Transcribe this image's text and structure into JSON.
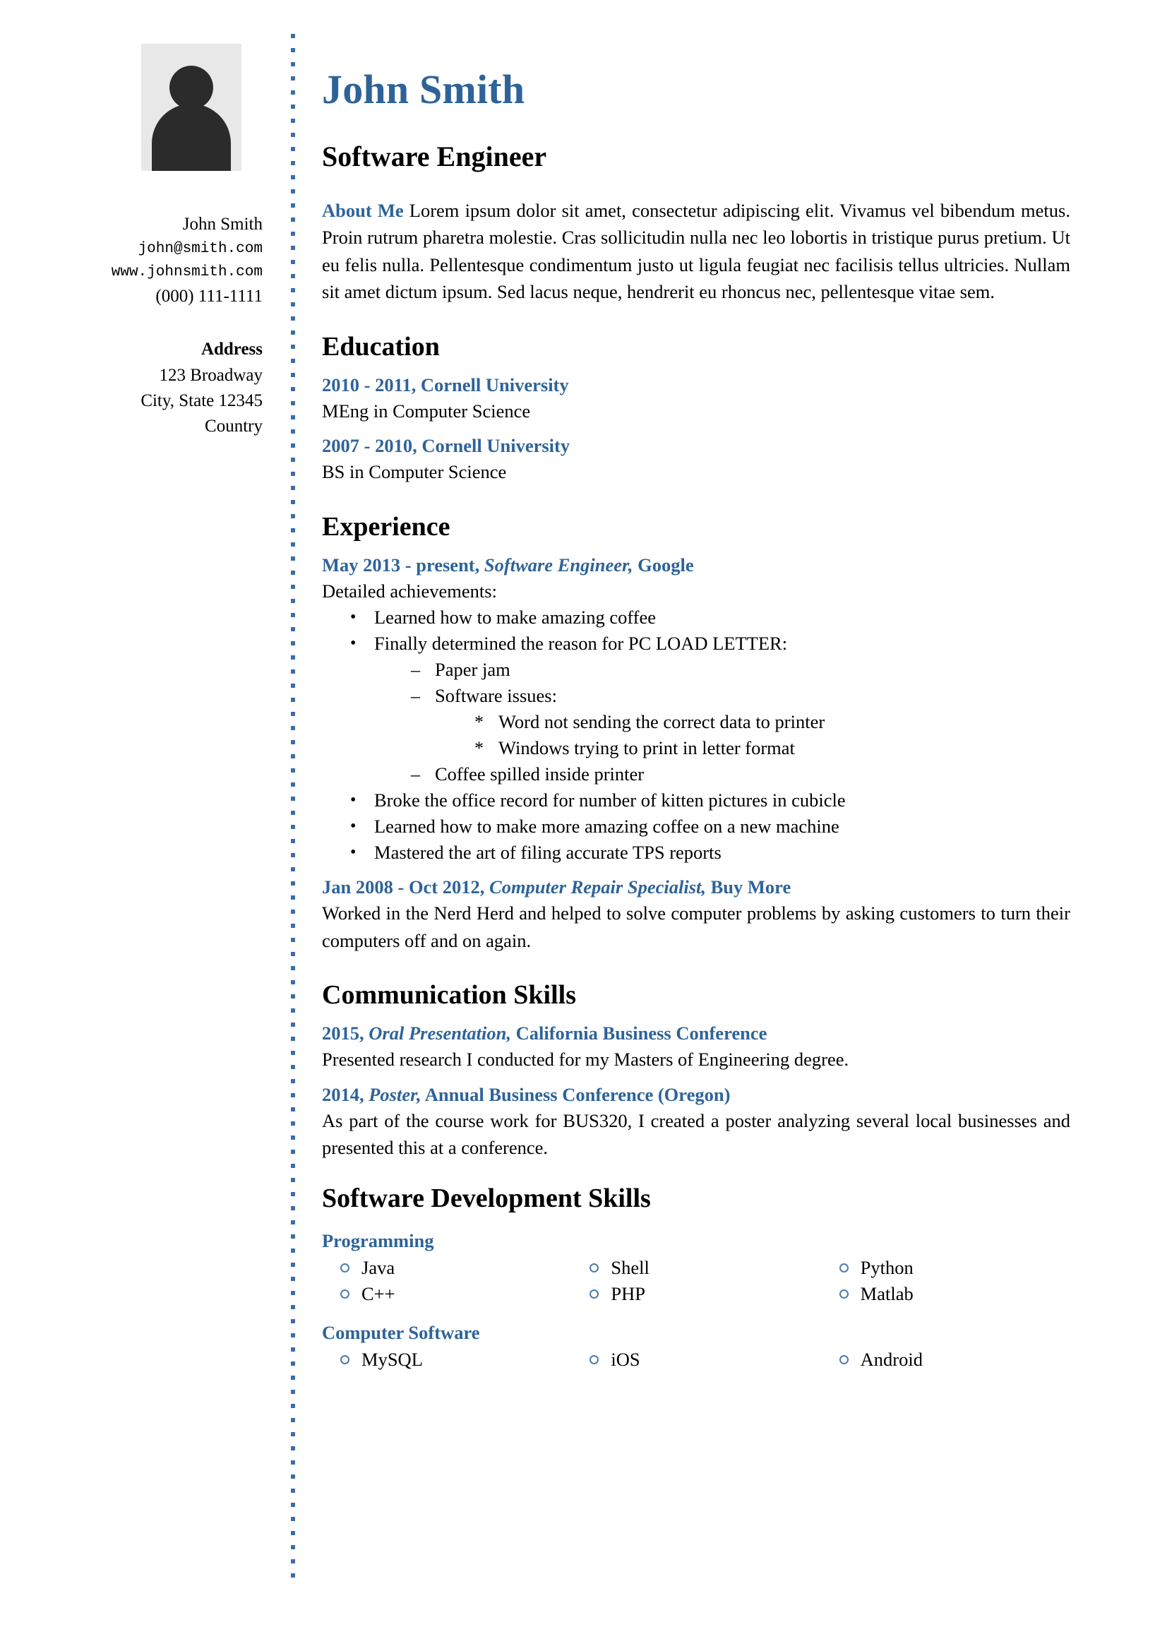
{
  "theme": {
    "accent_blue": "#2e6399",
    "divider_blue": "#3c6da8",
    "marker_blue": "#4a7cb0",
    "avatar_bg": "#e8e8e8",
    "avatar_fg": "#2b2b2b",
    "text_black": "#000000"
  },
  "sidebar": {
    "avatar_icon": "person-placeholder-icon",
    "contact": {
      "name": "John Smith",
      "email": "john@smith.com",
      "website": "www.johnsmith.com",
      "phone": "(000) 111-1111"
    },
    "address": {
      "title": "Address",
      "lines": [
        "123 Broadway",
        "City, State 12345",
        "Country"
      ]
    }
  },
  "header": {
    "name": "John Smith",
    "role": "Software Engineer"
  },
  "about": {
    "label": "About Me",
    "text": "Lorem ipsum dolor sit amet, consectetur adipiscing elit. Vivamus vel bibendum metus. Proin rutrum pharetra molestie. Cras sollicitudin nulla nec leo lobortis in tristique purus pretium. Ut eu felis nulla. Pellentesque condimentum justo ut ligula feugiat nec facilisis tellus ultricies. Nullam sit amet dictum ipsum. Sed lacus neque, hendrerit eu rhoncus nec, pellentesque vitae sem."
  },
  "education": {
    "title": "Education",
    "entries": [
      {
        "period": "2010 - 2011,",
        "institution": "Cornell University",
        "detail": "MEng in Computer Science"
      },
      {
        "period": "2007 - 2010,",
        "institution": "Cornell University",
        "detail": "BS in Computer Science"
      }
    ]
  },
  "experience": {
    "title": "Experience",
    "entries": [
      {
        "period": "May 2013 - present,",
        "role": "Software Engineer,",
        "company": "Google",
        "intro": "Detailed achievements:",
        "achievements": [
          {
            "text": "Learned how to make amazing coffee"
          },
          {
            "text": "Finally determined the reason for PC LOAD LETTER:",
            "children": [
              {
                "text": "Paper jam"
              },
              {
                "text": "Software issues:",
                "children": [
                  {
                    "text": "Word not sending the correct data to printer"
                  },
                  {
                    "text": "Windows trying to print in letter format"
                  }
                ]
              },
              {
                "text": "Coffee spilled inside printer"
              }
            ]
          },
          {
            "text": "Broke the office record for number of kitten pictures in cubicle"
          },
          {
            "text": "Learned how to make more amazing coffee on a new machine"
          },
          {
            "text": "Mastered the art of filing accurate TPS reports"
          }
        ]
      },
      {
        "period": "Jan 2008 - Oct 2012,",
        "role": "Computer Repair Specialist,",
        "company": "Buy More",
        "description": "Worked in the Nerd Herd and helped to solve computer problems by asking customers to turn their computers off and on again."
      }
    ]
  },
  "communication": {
    "title": "Communication Skills",
    "entries": [
      {
        "year": "2015,",
        "kind": "Oral Presentation,",
        "venue": "California Business Conference",
        "description": "Presented research I conducted for my Masters of Engineering degree."
      },
      {
        "year": "2014,",
        "kind": "Poster,",
        "venue": "Annual Business Conference (Oregon)",
        "description": "As part of the course work for BUS320, I created a poster analyzing several local businesses and presented this at a conference."
      }
    ]
  },
  "dev_skills": {
    "title": "Software Development Skills",
    "groups": [
      {
        "name": "Programming",
        "items": [
          "Java",
          "Shell",
          "Python",
          "C++",
          "PHP",
          "Matlab"
        ]
      },
      {
        "name": "Computer Software",
        "items": [
          "MySQL",
          "iOS",
          "Android"
        ]
      }
    ]
  },
  "markers": {
    "bullet": "•",
    "dash": "–",
    "star": "*"
  }
}
